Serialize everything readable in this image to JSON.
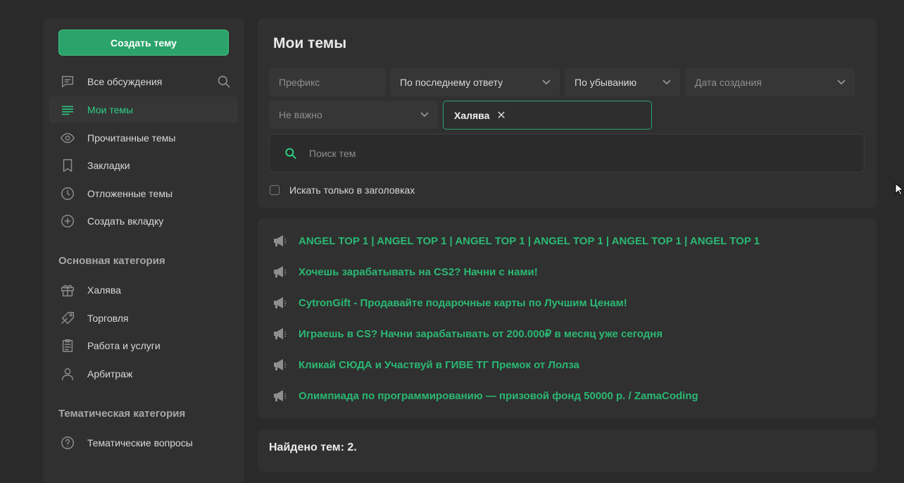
{
  "sidebar": {
    "create_button": "Создать тему",
    "nav_items": [
      {
        "label": "Все обсуждения",
        "icon": "chat-icon"
      },
      {
        "label": "Мои темы",
        "icon": "list-icon"
      },
      {
        "label": "Прочитанные темы",
        "icon": "eye-icon"
      },
      {
        "label": "Закладки",
        "icon": "bookmark-icon"
      },
      {
        "label": "Отложенные темы",
        "icon": "clock-icon"
      },
      {
        "label": "Создать вкладку",
        "icon": "plus-circle-icon"
      }
    ],
    "main_category": {
      "title": "Основная категория",
      "items": [
        {
          "label": "Халява",
          "icon": "gift-icon"
        },
        {
          "label": "Торговля",
          "icon": "tag-icon"
        },
        {
          "label": "Работа и услуги",
          "icon": "clipboard-icon"
        },
        {
          "label": "Арбитраж",
          "icon": "user-icon"
        }
      ]
    },
    "thematic_category": {
      "title": "Тематическая категория",
      "items": [
        {
          "label": "Тематические вопросы",
          "icon": "question-icon"
        }
      ]
    }
  },
  "filters": {
    "title": "Мои темы",
    "prefix_placeholder": "Префикс",
    "sort_by": "По последнему ответу",
    "order": "По убыванию",
    "date_placeholder": "Дата создания",
    "importance": "Не важно",
    "selected_tag": "Халява",
    "search_placeholder": "Поиск тем",
    "titles_only_label": "Искать только в заголовках"
  },
  "ads": [
    "ANGEL TOP 1 | ANGEL TOP 1 | ANGEL TOP 1 | ANGEL TOP 1 | ANGEL TOP 1 | ANGEL TOP 1",
    "Хочешь зарабатывать на CS2? Начни с нами!",
    "CytronGift - Продавайте подарочные карты по Лучшим Ценам!",
    "Играешь в CS? Начни зарабатывать от 200.000₽ в месяц уже сегодня",
    "Кликай СЮДА и Участвуй в ГИВЕ ТГ Премок от Лолза",
    "Олимпиада по программированию — призовой фонд 50000 р. / ZamaCoding"
  ],
  "results": {
    "found_text": "Найдено тем: 2."
  },
  "colors": {
    "accent": "#2bcf84",
    "button": "#2ba36b",
    "background": "#2a2a2a",
    "panel": "#303030"
  }
}
